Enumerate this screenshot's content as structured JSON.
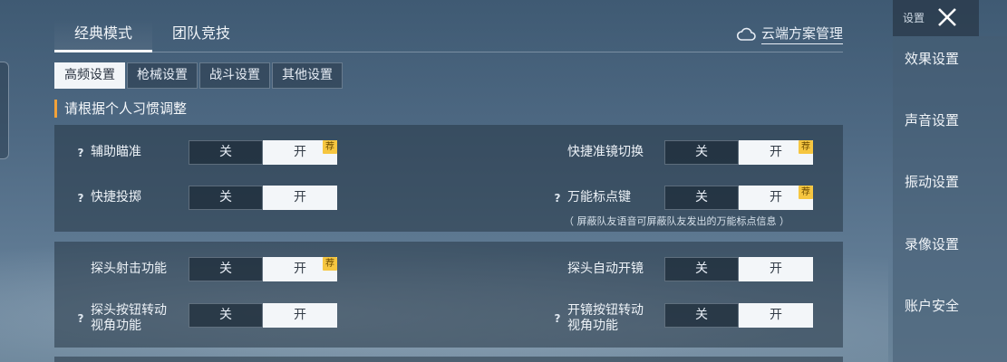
{
  "mode_tabs": [
    {
      "label": "经典模式",
      "active": true
    },
    {
      "label": "团队竞技",
      "active": false
    }
  ],
  "cloud_link": {
    "label": "云端方案管理",
    "icon": "cloud-icon"
  },
  "sub_tabs": [
    {
      "label": "高频设置",
      "active": true
    },
    {
      "label": "枪械设置",
      "active": false
    },
    {
      "label": "战斗设置",
      "active": false
    },
    {
      "label": "其他设置",
      "active": false
    }
  ],
  "section_title": "请根据个人习惯调整",
  "toggle_labels": {
    "off": "关",
    "on": "开"
  },
  "recommend_badge": "荐",
  "settings": {
    "aim_assist": {
      "label": "辅助瞄准",
      "help": "?",
      "value": "开",
      "recommended": true
    },
    "quick_scope_switch": {
      "label": "快捷准镜切换",
      "value": "开",
      "recommended": true
    },
    "quick_throw": {
      "label": "快捷投掷",
      "help": "?",
      "value": "开",
      "recommended": false
    },
    "universal_marker": {
      "label": "万能标点键",
      "help": "?",
      "value": "开",
      "recommended": true,
      "note": "（ 屏蔽队友语音可屏蔽队友发出的万能标点信息 ）"
    },
    "peek_fire": {
      "label": "探头射击功能",
      "value": "开",
      "recommended": true
    },
    "peek_auto_scope": {
      "label": "探头自动开镜",
      "value": "开",
      "recommended": false
    },
    "peek_button_turn": {
      "label_line1": "探头按钮转动",
      "label_line2": "视角功能",
      "help": "?",
      "value": "开",
      "recommended": false
    },
    "scope_button_turn": {
      "label_line1": "开镜按钮转动",
      "label_line2": "视角功能",
      "help": "?",
      "value": "开",
      "recommended": false
    }
  },
  "sidebar": {
    "title": "设置",
    "items": [
      "效果设置",
      "声音设置",
      "振动设置",
      "录像设置",
      "账户安全"
    ]
  },
  "colors": {
    "accent": "#f2a23a",
    "badge": "#f6c640",
    "toggle_on": "#f3f6f9"
  }
}
